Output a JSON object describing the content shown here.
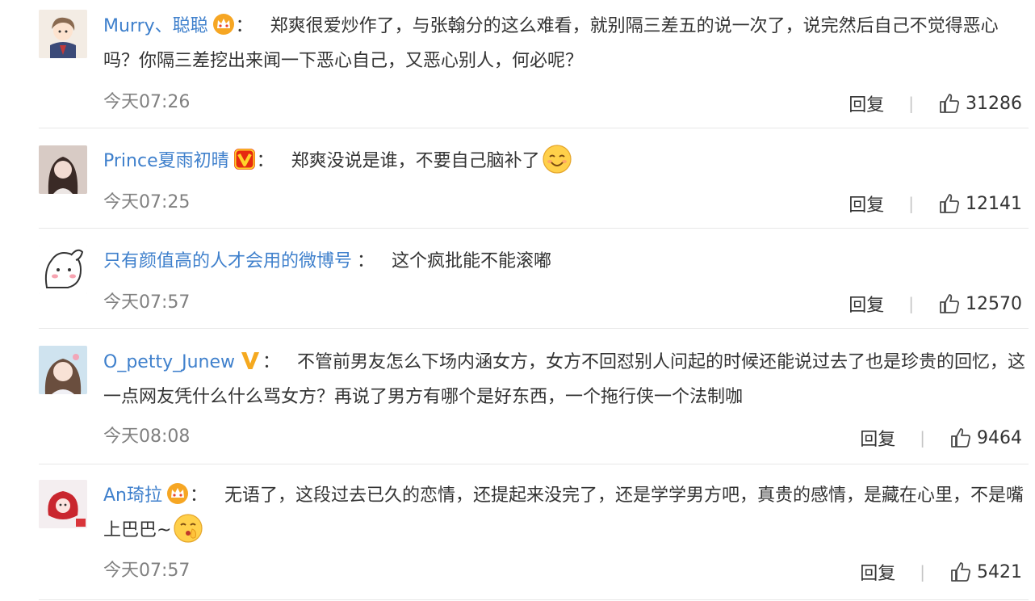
{
  "comments": [
    {
      "username": "Murry、聪聪",
      "badge": "crown-icon",
      "text": "郑爽很爱炒作了，与张翰分的这么难看，就别隔三差五的说一次了，说完然后自己不觉得恶心吗？你隔三差挖出来闻一下恶心自己，又恶心别人，何必呢？",
      "emoji": "",
      "time": "今天07:26",
      "reply_label": "回复",
      "likes": "31286"
    },
    {
      "username": "Prince夏雨初晴",
      "badge": "vip-v-icon",
      "text": "郑爽没说是谁，不要自己脑补了",
      "emoji": "smile-emoji",
      "time": "今天07:25",
      "reply_label": "回复",
      "likes": "12141"
    },
    {
      "username": "只有颜值高的人才会用的微博号",
      "badge": "",
      "text": "这个疯批能不能滚嘟",
      "emoji": "",
      "time": "今天07:57",
      "reply_label": "回复",
      "likes": "12570"
    },
    {
      "username": "O_petty_Junew",
      "badge": "verified-v-icon",
      "text": "不管前男友怎么下场内涵女方，女方不回怼别人问起的时候还能说过去了也是珍贵的回忆，这一点网友凭什么什么骂女方？再说了男方有哪个是好东西，一个拖行侠一个法制咖",
      "emoji": "",
      "time": "今天08:08",
      "reply_label": "回复",
      "likes": "9464"
    },
    {
      "username": "An琦拉",
      "badge": "crown-icon",
      "text": "无语了，这段过去已久的恋情，还提起来没完了，还是学学男方吧，真贵的感情，是藏在心里，不是嘴上巴巴~",
      "emoji": "shush-emoji",
      "time": "今天07:57",
      "reply_label": "回复",
      "likes": "5421"
    }
  ],
  "colors": {
    "username": "#3f80cc",
    "text": "#333333",
    "time": "#808080",
    "divider": "#e8e8e8"
  }
}
